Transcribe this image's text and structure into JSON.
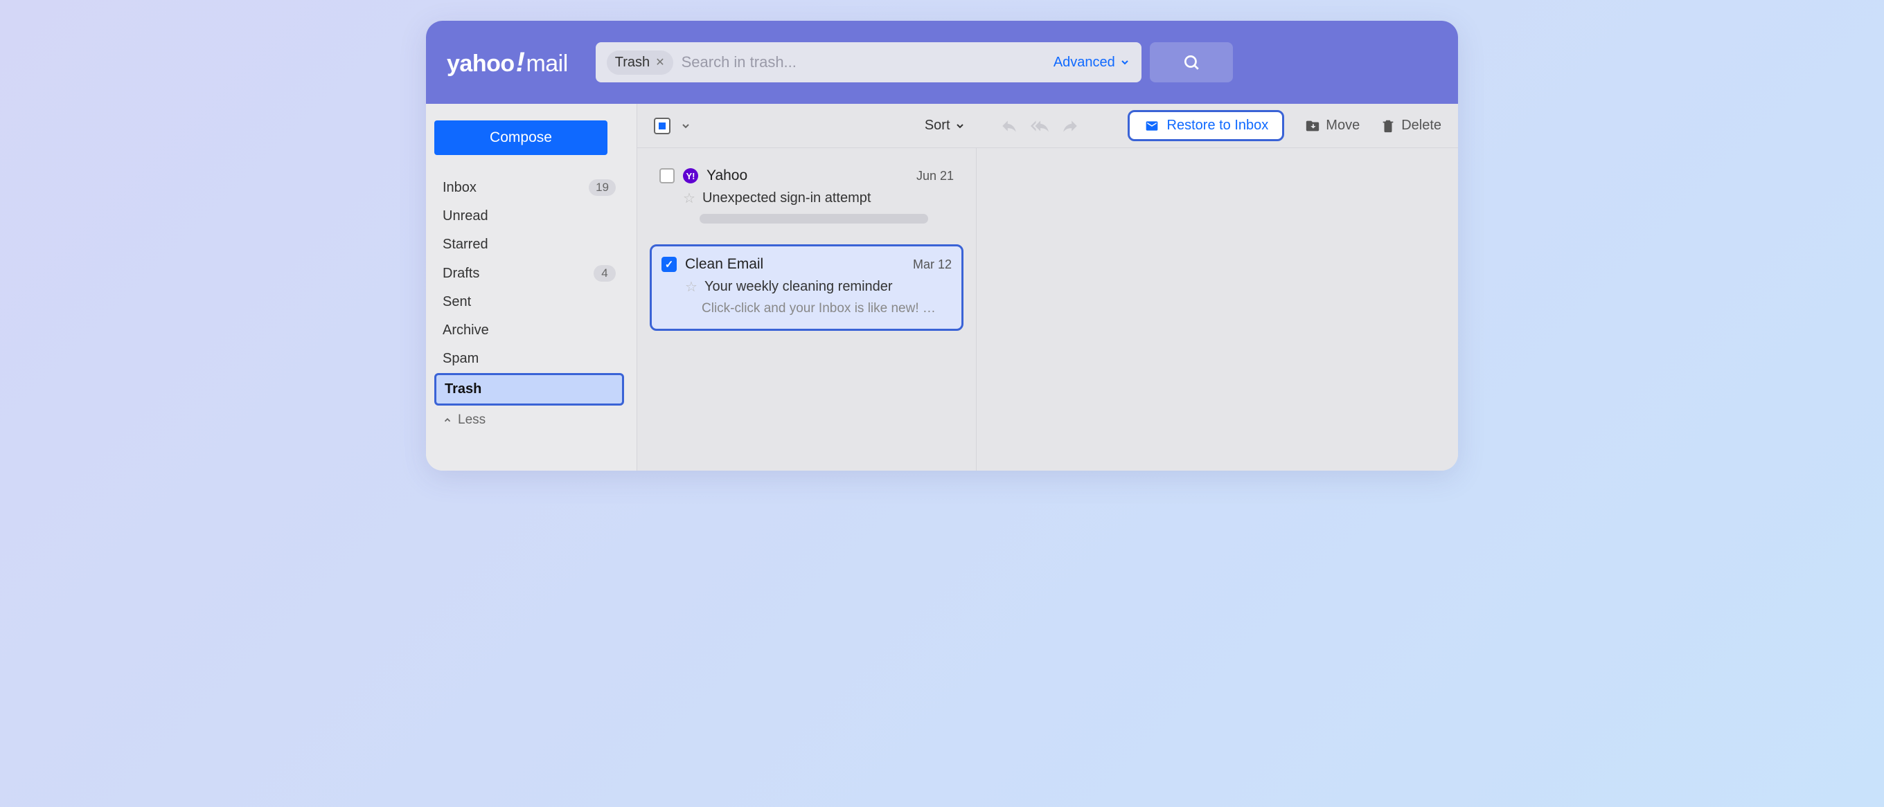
{
  "brand": {
    "part1": "yahoo",
    "bang": "!",
    "part2": "mail"
  },
  "search": {
    "chip_label": "Trash",
    "placeholder": "Search in trash...",
    "advanced_label": "Advanced"
  },
  "compose_label": "Compose",
  "folders": [
    {
      "label": "Inbox",
      "count": "19",
      "active": false
    },
    {
      "label": "Unread",
      "count": "",
      "active": false
    },
    {
      "label": "Starred",
      "count": "",
      "active": false
    },
    {
      "label": "Drafts",
      "count": "4",
      "active": false
    },
    {
      "label": "Sent",
      "count": "",
      "active": false
    },
    {
      "label": "Archive",
      "count": "",
      "active": false
    },
    {
      "label": "Spam",
      "count": "",
      "active": false
    },
    {
      "label": "Trash",
      "count": "",
      "active": true
    }
  ],
  "less_label": "Less",
  "toolbar": {
    "sort_label": "Sort",
    "restore_label": "Restore to Inbox",
    "move_label": "Move",
    "delete_label": "Delete"
  },
  "messages": [
    {
      "sender": "Yahoo",
      "sender_badge": "Y!",
      "date": "Jun 21",
      "subject": "Unexpected sign-in attempt",
      "snippet": "",
      "checked": false,
      "selected": false,
      "show_snippet_bar": true
    },
    {
      "sender": "Clean Email",
      "sender_badge": "",
      "date": "Mar 12",
      "subject": "Your weekly cleaning reminder",
      "snippet": "Click-click and your Inbox is like new! …",
      "checked": true,
      "selected": true,
      "show_snippet_bar": false
    }
  ],
  "colors": {
    "header": "#6f76d9",
    "primary": "#0f69ff",
    "highlight_border": "#3a63d6",
    "highlight_bg": "#dde5fc"
  }
}
